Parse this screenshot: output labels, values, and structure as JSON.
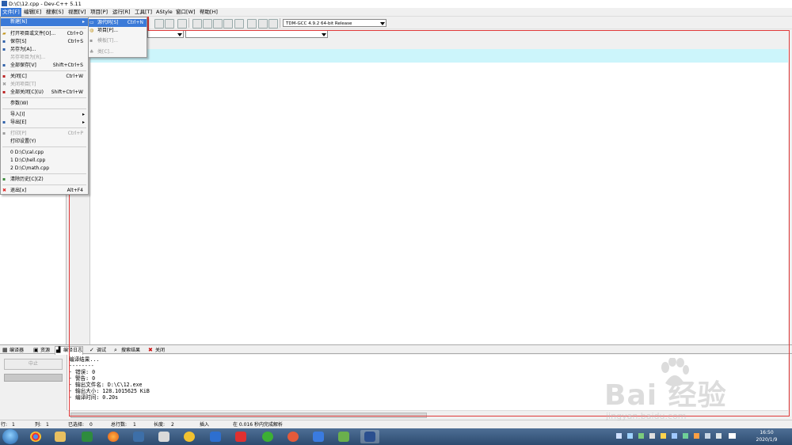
{
  "window": {
    "title": "D:\\C\\12.cpp - Dev-C++ 5.11"
  },
  "menubar": {
    "items": [
      {
        "label": "文件[F]"
      },
      {
        "label": "编辑[E]"
      },
      {
        "label": "搜索[S]"
      },
      {
        "label": "视图[V]"
      },
      {
        "label": "项目[P]"
      },
      {
        "label": "运行[R]"
      },
      {
        "label": "工具[T]"
      },
      {
        "label": "AStyle"
      },
      {
        "label": "窗口[W]"
      },
      {
        "label": "帮助[H]"
      }
    ]
  },
  "toolbar": {
    "compiler_select": "TDM-GCC 4.9.2 64-bit Release"
  },
  "file_menu": {
    "items": [
      {
        "label": "新建[N]",
        "shortcut": "",
        "highlighted": true
      },
      {
        "label": "打开项目或文件[O]...",
        "shortcut": "Ctrl+O"
      },
      {
        "label": "保存[S]",
        "shortcut": "Ctrl+S"
      },
      {
        "label": "另存为[A]...",
        "shortcut": ""
      },
      {
        "label": "另存项目为[R]...",
        "shortcut": "",
        "disabled": true
      },
      {
        "label": "全部保存[V]",
        "shortcut": "Shift+Ctrl+S"
      },
      {
        "label": "关闭[C]",
        "shortcut": "Ctrl+W"
      },
      {
        "label": "关闭项目[T]",
        "shortcut": "",
        "disabled": true
      },
      {
        "label": "全部关闭[C](U)",
        "shortcut": "Shift+Ctrl+W"
      },
      {
        "label": "参数(W)",
        "shortcut": ""
      },
      {
        "label": "导入[I]",
        "shortcut": ""
      },
      {
        "label": "导出[E]",
        "shortcut": ""
      },
      {
        "label": "打印[P]",
        "shortcut": "Ctrl+P",
        "disabled": true
      },
      {
        "label": "打印设置(Y)",
        "shortcut": ""
      },
      {
        "label": "0 D:\\C\\cal.cpp",
        "shortcut": ""
      },
      {
        "label": "1 D:\\C\\hell.cpp",
        "shortcut": ""
      },
      {
        "label": "2 D:\\C\\math.cpp",
        "shortcut": ""
      },
      {
        "label": "清除历史[C](Z)",
        "shortcut": ""
      },
      {
        "label": "退出[x]",
        "shortcut": "Alt+F4"
      }
    ]
  },
  "new_submenu": {
    "items": [
      {
        "label": "源代码[S]",
        "shortcut": "Ctrl+N",
        "highlighted": true
      },
      {
        "label": "项目[P]...",
        "shortcut": ""
      },
      {
        "label": "模板[T]...",
        "shortcut": "",
        "disabled": true
      },
      {
        "label": "类[C]...",
        "shortcut": "",
        "disabled": true
      }
    ]
  },
  "bottom_tabs": [
    {
      "label": "编译器"
    },
    {
      "label": "资源"
    },
    {
      "label": "编译日志"
    },
    {
      "label": "调试"
    },
    {
      "label": "搜索结果"
    },
    {
      "label": "关闭"
    }
  ],
  "compile_panel": {
    "abort_label": "中止"
  },
  "compile_log": [
    "编译结果...",
    "--------",
    "- 错误: 0",
    "- 警告: 0",
    "- 输出文件名: D:\\C\\12.exe",
    "- 输出大小: 128.1015625 KiB",
    "- 编译时间: 0.20s"
  ],
  "statusbar": {
    "row_label": "行:",
    "row_value": "1",
    "col_label": "列:",
    "col_value": "1",
    "selected_label": "已选择:",
    "selected_value": "0",
    "total_lines_label": "总行数:",
    "total_lines_value": "1",
    "length_label": "长度:",
    "length_value": "2",
    "mode": "插入",
    "parse_info": "在 0.016 秒内完成解析"
  },
  "taskbar": {
    "time": "16:50",
    "date": "2020/1/9"
  },
  "watermark": {
    "brand": "Bai  经验",
    "url": "jingyan.baidu.com"
  },
  "colors": {
    "menu_highlight": "#3b7ad8",
    "editor_current_line": "#ccf5fb",
    "annotation_frame": "#e03a3a"
  }
}
